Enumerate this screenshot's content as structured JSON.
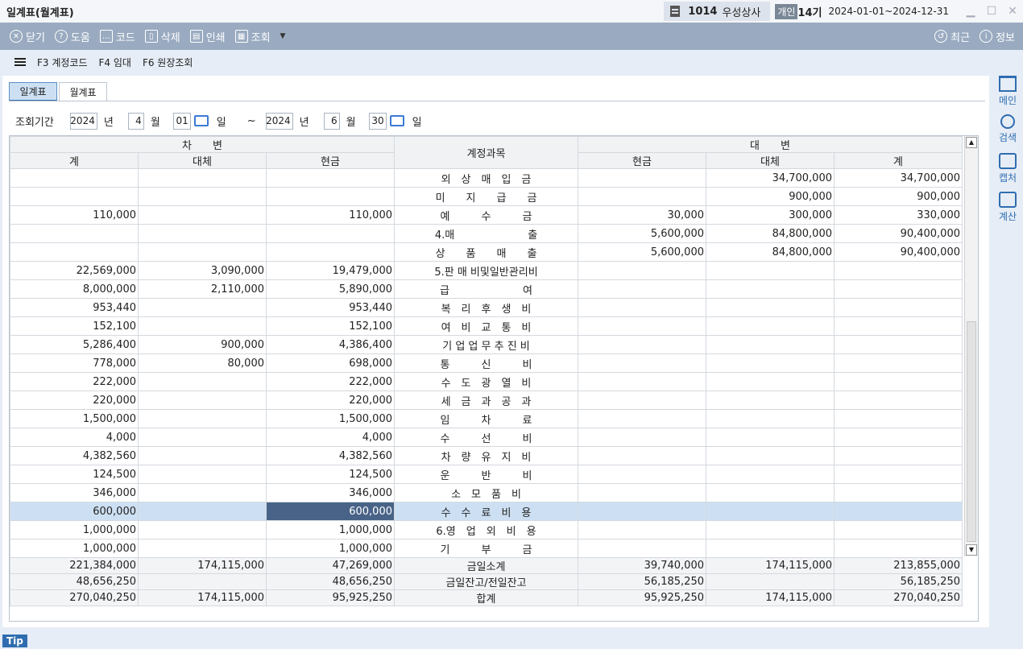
{
  "window": {
    "title": "일계표(월계표)",
    "company_code": "1014",
    "company_name": "우성상사",
    "badge": "개인",
    "era": "14기",
    "period": "2024-01-01~2024-12-31"
  },
  "toolbar": {
    "close": "닫기",
    "help": "도움",
    "code": "코드",
    "delete": "삭제",
    "print": "인쇄",
    "search": "조회",
    "recent": "최근",
    "info": "정보"
  },
  "fkeys": [
    "F3 계정코드",
    "F4 임대",
    "F6 원장조회"
  ],
  "tabs": [
    "일계표",
    "월계표"
  ],
  "query": {
    "label": "조회기간",
    "y1": "2024",
    "m1": "4",
    "d1": "01",
    "y2": "2024",
    "m2": "6",
    "d2": "30",
    "yr": "년",
    "mo": "월",
    "dy": "일",
    "tilde": "~"
  },
  "header": {
    "debit": "차　　변",
    "credit": "대　　변",
    "account": "계정과목",
    "total": "계",
    "transfer": "대체",
    "cash": "현금"
  },
  "rows": [
    [
      "",
      "",
      "",
      "외　상　매　입　금",
      "",
      "34,700,000",
      "34,700,000"
    ],
    [
      "",
      "",
      "",
      "미　　지　　급　　금",
      "",
      "900,000",
      "900,000"
    ],
    [
      "110,000",
      "",
      "110,000",
      "예　　　수　　　금",
      "30,000",
      "300,000",
      "330,000"
    ],
    [
      "",
      "",
      "",
      "4.매　　　　　　　출",
      "5,600,000",
      "84,800,000",
      "90,400,000"
    ],
    [
      "",
      "",
      "",
      "상　　품　　매　　출",
      "5,600,000",
      "84,800,000",
      "90,400,000"
    ],
    [
      "22,569,000",
      "3,090,000",
      "19,479,000",
      "5.판 매 비및일반관리비",
      "",
      "",
      ""
    ],
    [
      "8,000,000",
      "2,110,000",
      "5,890,000",
      "급　　　　　　　여",
      "",
      "",
      ""
    ],
    [
      "953,440",
      "",
      "953,440",
      "복　리　후　생　비",
      "",
      "",
      ""
    ],
    [
      "152,100",
      "",
      "152,100",
      "여　비　교　통　비",
      "",
      "",
      ""
    ],
    [
      "5,286,400",
      "900,000",
      "4,386,400",
      "기 업 업 무 추 진 비",
      "",
      "",
      ""
    ],
    [
      "778,000",
      "80,000",
      "698,000",
      "통　　　신　　　비",
      "",
      "",
      ""
    ],
    [
      "222,000",
      "",
      "222,000",
      "수　도　광　열　비",
      "",
      "",
      ""
    ],
    [
      "220,000",
      "",
      "220,000",
      "세　금　과　공　과",
      "",
      "",
      ""
    ],
    [
      "1,500,000",
      "",
      "1,500,000",
      "임　　　차　　　료",
      "",
      "",
      ""
    ],
    [
      "4,000",
      "",
      "4,000",
      "수　　　선　　　비",
      "",
      "",
      ""
    ],
    [
      "4,382,560",
      "",
      "4,382,560",
      "차　량　유　지　비",
      "",
      "",
      ""
    ],
    [
      "124,500",
      "",
      "124,500",
      "운　　　반　　　비",
      "",
      "",
      ""
    ],
    [
      "346,000",
      "",
      "346,000",
      "소　모　품　비",
      "",
      "",
      ""
    ],
    [
      "600,000",
      "",
      "600,000",
      "수　수　료　비　용",
      "",
      "",
      ""
    ],
    [
      "1,000,000",
      "",
      "1,000,000",
      "6.영　업　외　비　용",
      "",
      "",
      ""
    ],
    [
      "1,000,000",
      "",
      "1,000,000",
      "기　　　부　　　금",
      "",
      "",
      ""
    ]
  ],
  "totals": [
    [
      "221,384,000",
      "174,115,000",
      "47,269,000",
      "금일소계",
      "39,740,000",
      "174,115,000",
      "213,855,000"
    ],
    [
      "48,656,250",
      "",
      "48,656,250",
      "금일잔고/전일잔고",
      "56,185,250",
      "",
      "56,185,250"
    ],
    [
      "270,040,250",
      "174,115,000",
      "95,925,250",
      "합계",
      "95,925,250",
      "174,115,000",
      "270,040,250"
    ]
  ],
  "sidebar": {
    "main": "메인",
    "search": "검색",
    "capture": "캡처",
    "calc": "계산"
  },
  "tip": "Tip"
}
